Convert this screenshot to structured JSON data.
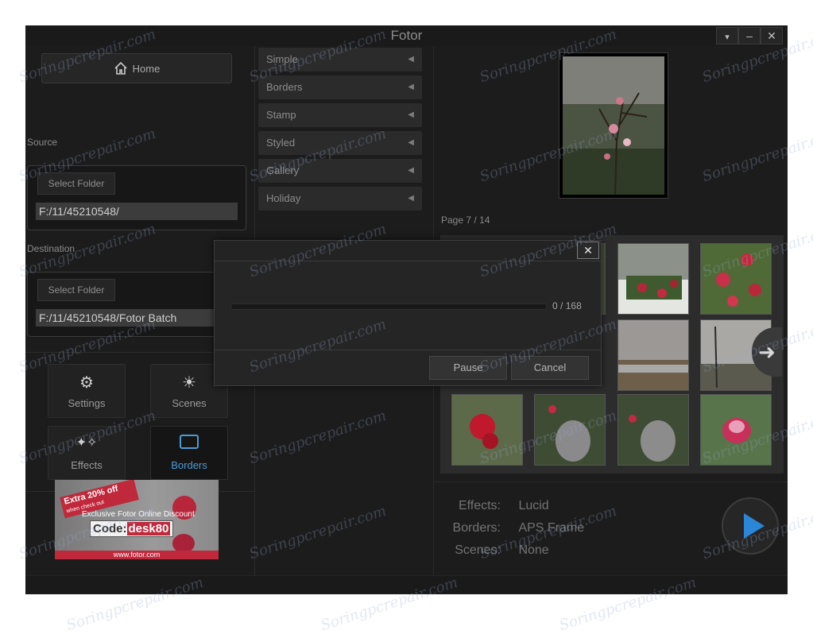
{
  "window": {
    "title": "Fotor"
  },
  "left": {
    "home_label": "Home",
    "source_label": "Source",
    "source_button": "Select Folder",
    "source_path": "F:/11/45210548/",
    "destination_label": "Destination",
    "destination_button": "Select Folder",
    "destination_path": "F:/11/45210548/Fotor Batch",
    "tiles": [
      {
        "label": "Settings",
        "icon": "gear-icon"
      },
      {
        "label": "Scenes",
        "icon": "sun-icon"
      },
      {
        "label": "Effects",
        "icon": "sparkle-icon"
      },
      {
        "label": "Borders",
        "icon": "frame-icon"
      }
    ],
    "ad": {
      "ribbon": "Extra 20% off",
      "ribbon_sub": "when check out",
      "line": "Exclusive Fotor Online Discount",
      "code_prefix": "Code:",
      "code": "desk80",
      "site": "www.fotor.com"
    }
  },
  "categories": [
    "Simple",
    "Borders",
    "Stamp",
    "Styled",
    "Gallery",
    "Holiday"
  ],
  "right": {
    "page_label": "Page",
    "page_current": "7",
    "page_sep": "/",
    "page_total": "14",
    "info": {
      "effects_label": "Effects:",
      "effects_value": "Lucid",
      "borders_label": "Borders:",
      "borders_value": "APS Frame",
      "scenes_label": "Scenes:",
      "scenes_value": "None"
    }
  },
  "modal": {
    "progress_current": "0",
    "progress_sep": "/",
    "progress_total": "168",
    "progress_fraction": 0,
    "pause_label": "Pause",
    "cancel_label": "Cancel"
  },
  "watermark": "Soringpcrepair.com",
  "colors": {
    "accent": "#3a8fd8",
    "background": "#1c1c1c"
  }
}
